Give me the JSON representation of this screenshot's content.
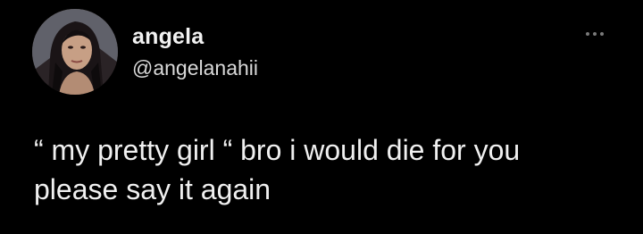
{
  "tweet": {
    "author": {
      "display_name": "angela",
      "handle": "@angelanahii",
      "avatar_icon": "profile-photo-avatar"
    },
    "more_icon": "more-options-icon",
    "body_lines": [
      "“ my pretty girl “ bro i would die for you",
      "please say it again"
    ]
  },
  "colors": {
    "background": "#000000",
    "text_primary": "#f0f0f0",
    "text_secondary": "#d9d9d9",
    "icon_muted": "#7a7a7a"
  }
}
